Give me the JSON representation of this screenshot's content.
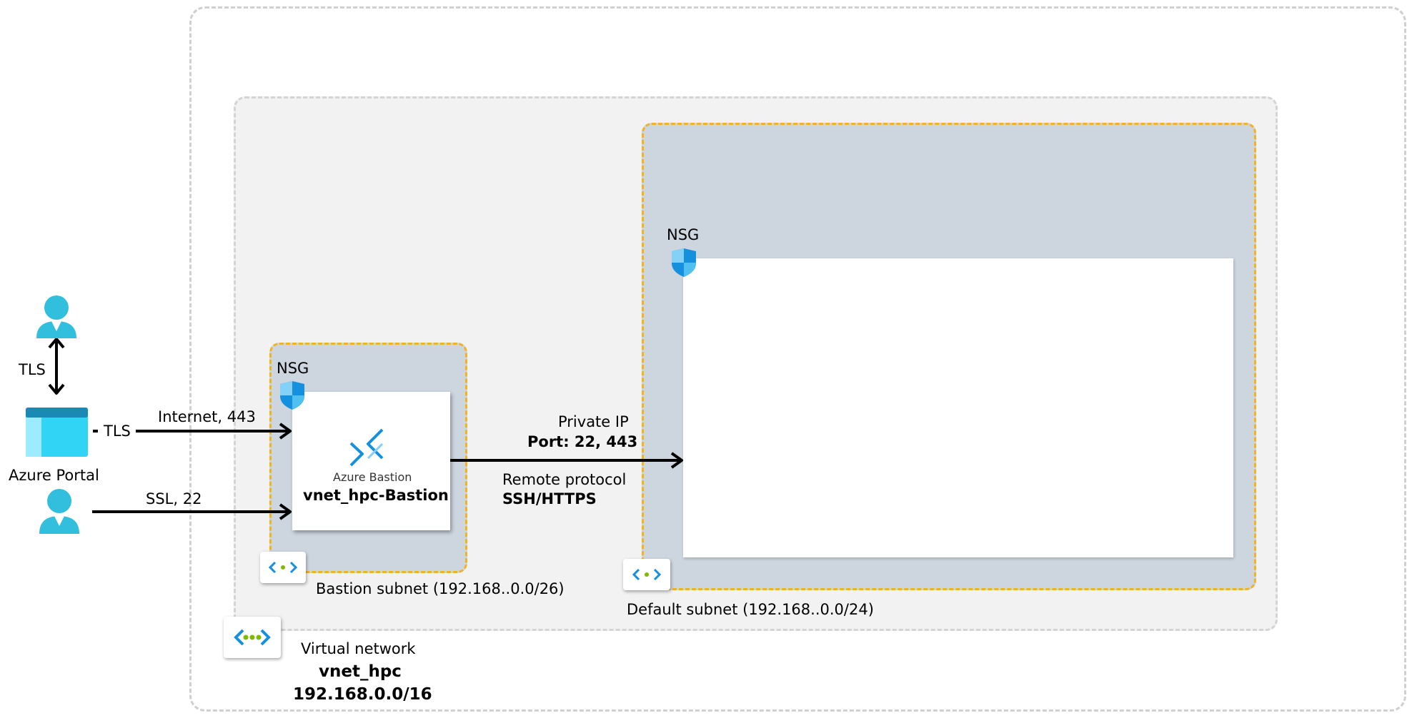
{
  "user_auth": {
    "tls_label": "TLS"
  },
  "portal": {
    "label": "Azure Portal",
    "side_tls_label": "TLS"
  },
  "connections": {
    "internet_label": "Internet, 443",
    "ssl_label": "SSL, 22",
    "private_ip_label": "Private IP",
    "port_label": "Port: 22, 443",
    "remote_protocol_label": "Remote protocol",
    "ssh_https_label": "SSH/HTTPS"
  },
  "bastion": {
    "service_label": "Azure Bastion",
    "name": "vnet_hpc-Bastion",
    "nsg_label": "NSG",
    "subnet_label": "Bastion subnet (192.168..0.0/26)"
  },
  "default_subnet": {
    "nsg_label": "NSG",
    "subnet_label": "Default subnet (192.168..0.0/24)"
  },
  "vnet": {
    "type_label": "Virtual network",
    "name": "vnet_hpc",
    "cidr": "192.168.0.0/16"
  },
  "colors": {
    "subnet_border": "#f3b31c",
    "subnet_fill": "#cdd5df",
    "azure_blue": "#1490df",
    "user_cyan": "#32bedd",
    "region_fill": "#f2f2f2"
  },
  "icons": [
    "user-icon",
    "azure-portal-icon",
    "nsg-shield-icon",
    "azure-bastion-icon",
    "virtual-network-icon"
  ]
}
